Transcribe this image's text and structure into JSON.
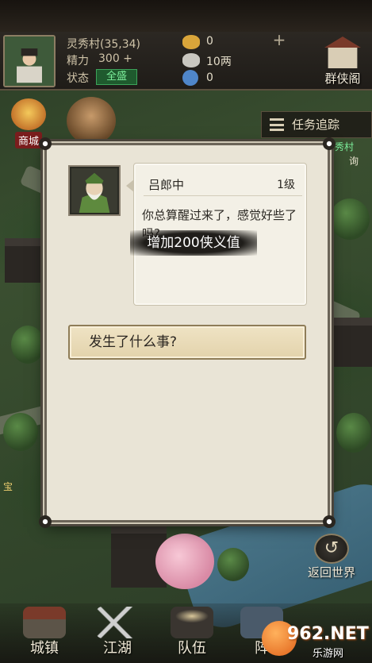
{
  "hud": {
    "location": "灵秀村(35,34)",
    "energy_label": "精力",
    "energy_value": "300 +",
    "status_label": "状态",
    "status_value": "全盛",
    "gold": "0",
    "silver": "10两",
    "jade": "0",
    "plus_symbol": "+",
    "guild_label": "群侠阁"
  },
  "side": {
    "shop_label": "商城",
    "task_tracker_label": "任务追踪"
  },
  "map_labels": {
    "village": "秀村",
    "inquire": "询",
    "treasure": "宝"
  },
  "dialog": {
    "npc_name": "吕郎中",
    "npc_level": "1级",
    "speech": "你总算醒过来了，感觉好些了吗?",
    "toast": "增加200侠义值",
    "option": "发生了什么事?"
  },
  "bottom_nav": {
    "items": [
      {
        "label": "城镇"
      },
      {
        "label": "江湖"
      },
      {
        "label": "队伍"
      },
      {
        "label": "阵"
      }
    ],
    "return_label": "返回世界"
  },
  "watermark": {
    "brand": "962.NET",
    "sub": "乐游网"
  },
  "colors": {
    "status_green": "#3ca35a",
    "dialog_bg": "#e9e4d6",
    "option_bg": "#e3d3ac"
  }
}
